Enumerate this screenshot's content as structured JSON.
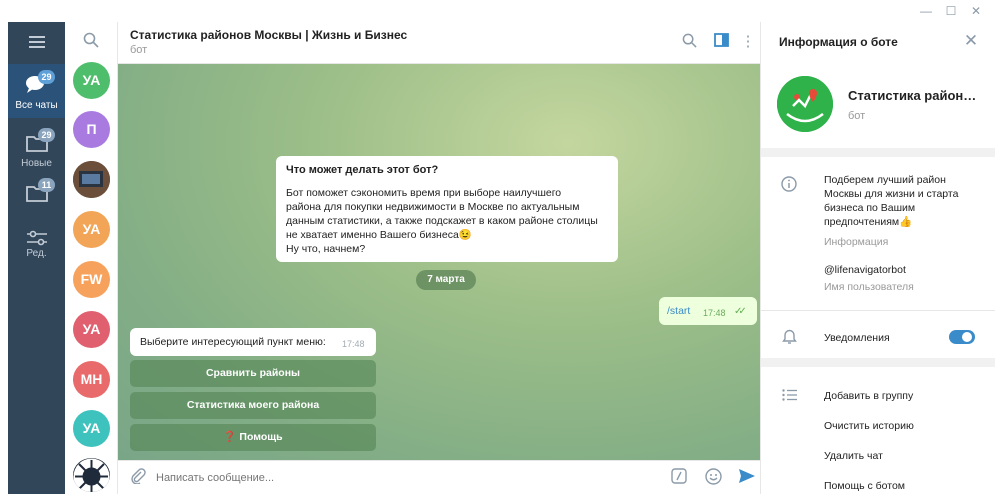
{
  "window": {
    "minimize_icon": "minimize-icon",
    "maximize_icon": "maximize-icon",
    "close_icon": "close-icon"
  },
  "rail": {
    "items": [
      {
        "label": "Все чаты",
        "badge": "29",
        "icon": "chats-icon"
      },
      {
        "label": "Новые",
        "badge": "29",
        "icon": "folder-icon"
      },
      {
        "label": "",
        "badge": "11",
        "icon": "folder-icon"
      },
      {
        "label": "Ред.",
        "badge": "",
        "icon": "edit-filters-icon"
      }
    ]
  },
  "avatars": [
    {
      "initials": "УА",
      "color": "#4fbe6c"
    },
    {
      "initials": "П",
      "color": "#a97be0"
    },
    {
      "initials": "",
      "color": "#6b4f3a"
    },
    {
      "initials": "УА",
      "color": "#f2a457"
    },
    {
      "initials": "FW",
      "color": "#f6a25c"
    },
    {
      "initials": "УА",
      "color": "#e06070"
    },
    {
      "initials": "МН",
      "color": "#e86a6a"
    },
    {
      "initials": "УА",
      "color": "#3ec2bd"
    },
    {
      "initials": "",
      "color": "#1f2b3a"
    }
  ],
  "chat": {
    "title": "Статистика районов Москвы | Жизнь и Бизнес",
    "subtitle": "бот",
    "info_title": "Что может делать этот бот?",
    "info_lines": [
      "Бот поможет сэкономить время при выборе наилучшего",
      "района для покупки недвижимости в Москве по актуальным",
      "данным статистики, а также подскажет в каком районе столицы",
      "не хватает именно Вашего бизнеса😉",
      "Ну что, начнем?"
    ],
    "date": "7 марта",
    "out_message": {
      "text": "/start",
      "time": "17:48"
    },
    "in_message": {
      "text": "Выберите интересующий пункт меню:",
      "time": "17:48"
    },
    "keyboard": [
      "Сравнить районы",
      "Статистика моего района",
      "❓ Помощь"
    ],
    "composer_placeholder": "Написать сообщение..."
  },
  "panel": {
    "title": "Информация о боте",
    "name": "Статистика район…",
    "subtitle": "бот",
    "description_lines": [
      "Подберем лучший район",
      "Москвы для жизни и старта",
      "бизнеса по Вашим",
      "предпочтениям👍"
    ],
    "description_label": "Информация",
    "username": "@lifenavigatorbot",
    "username_label": "Имя пользователя",
    "notifications_label": "Уведомления",
    "notifications_on": true,
    "actions": [
      "Добавить в группу",
      "Очистить историю",
      "Удалить чат",
      "Помощь с ботом"
    ]
  },
  "colors": {
    "accent": "#3a8bc9",
    "rail": "#32465a",
    "bot_avatar": "#2fb24a"
  }
}
